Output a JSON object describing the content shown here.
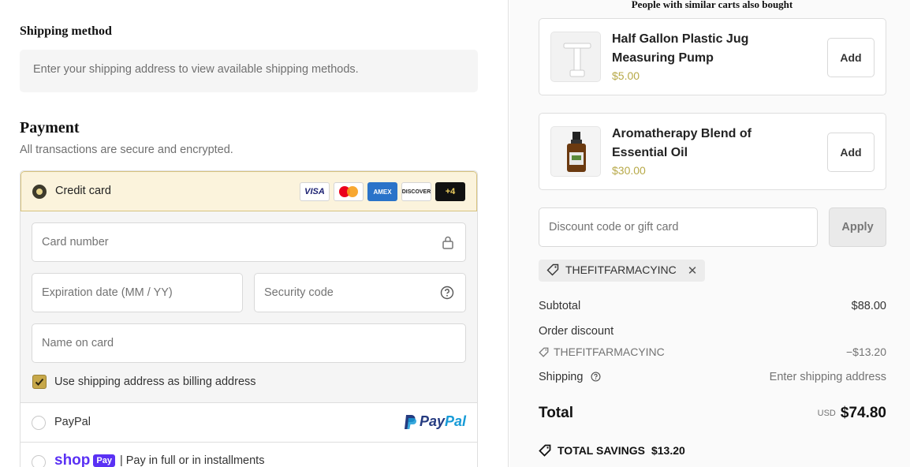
{
  "shipping": {
    "title": "Shipping method",
    "placeholder_text": "Enter your shipping address to view available shipping methods."
  },
  "payment": {
    "title": "Payment",
    "subtitle": "All transactions are secure and encrypted.",
    "credit_card": {
      "label": "Credit card",
      "selected": true,
      "card_logos": [
        "VISA",
        "mastercard",
        "AMEX",
        "DISCOVER",
        "+4"
      ],
      "fields": {
        "card_number": "Card number",
        "expiration": "Expiration date (MM / YY)",
        "security_code": "Security code",
        "name_on_card": "Name on card"
      },
      "billing_checkbox_label": "Use shipping address as billing address",
      "billing_checked": true
    },
    "paypal": {
      "label": "PayPal",
      "logo_text_1": "Pay",
      "logo_text_2": "Pal"
    },
    "shop_pay": {
      "logo_word": "shop",
      "logo_badge": "Pay",
      "text": "| Pay in full or in installments"
    }
  },
  "recommendations": {
    "title": "People with similar carts also bought",
    "items": [
      {
        "name": "Half Gallon Plastic Jug Measuring Pump",
        "price": "$5.00",
        "button": "Add",
        "icon": "pump-image"
      },
      {
        "name": "Aromatherapy Blend of Essential Oil",
        "price": "$30.00",
        "button": "Add",
        "icon": "oil-bottle-image"
      }
    ]
  },
  "discount": {
    "placeholder": "Discount code or gift card",
    "apply_label": "Apply",
    "applied_code": "THEFITFARMACYINC"
  },
  "summary": {
    "subtotal_label": "Subtotal",
    "subtotal_value": "$88.00",
    "order_discount_label": "Order discount",
    "discount_code": "THEFITFARMACYINC",
    "discount_value": "−$13.20",
    "shipping_label": "Shipping",
    "shipping_value": "Enter shipping address",
    "total_label": "Total",
    "currency": "USD",
    "total_value": "$74.80",
    "savings_label": "TOTAL SAVINGS",
    "savings_value": "$13.20"
  },
  "colors": {
    "accent_gold": "#c7a84a",
    "selected_bg": "#fbf3dc",
    "price_color": "#b7a948",
    "shop_pay_purple": "#5a31f4"
  }
}
